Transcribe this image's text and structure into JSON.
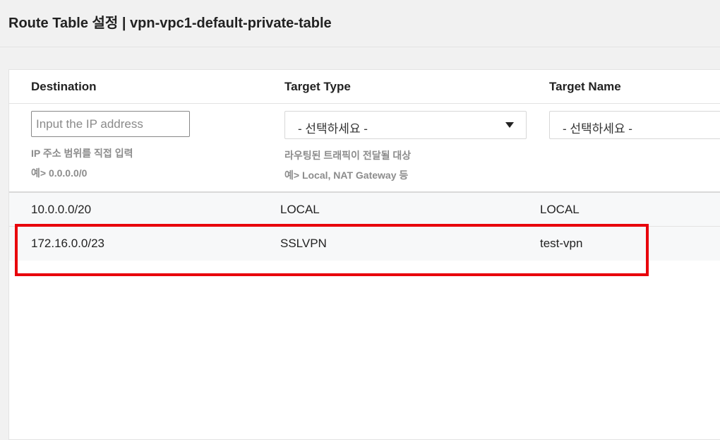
{
  "header": {
    "title": "Route Table 설정 | vpn-vpc1-default-private-table"
  },
  "table": {
    "columns": [
      "Destination",
      "Target Type",
      "Target Name"
    ],
    "filters": {
      "destination": {
        "placeholder": "Input the IP address",
        "hint_line1": "IP 주소 범위를 직접 입력",
        "hint_line2": "예> 0.0.0.0/0"
      },
      "target_type": {
        "selected": "- 선택하세요 -",
        "hint_line1": "라우팅된 트래픽이 전달될 대상",
        "hint_line2": "예> Local, NAT Gateway 등"
      },
      "target_name": {
        "selected": "- 선택하세요 -"
      }
    },
    "rows": [
      {
        "destination": "10.0.0.0/20",
        "target_type": "LOCAL",
        "target_name": "LOCAL"
      },
      {
        "destination": "172.16.0.0/23",
        "target_type": "SSLVPN",
        "target_name": "test-vpn"
      }
    ]
  },
  "colors": {
    "highlight": "#e8000b",
    "row_background": "#f7f8f9",
    "page_background": "#f1f1f1"
  },
  "icons": {
    "select_caret": "caret-down-icon"
  }
}
